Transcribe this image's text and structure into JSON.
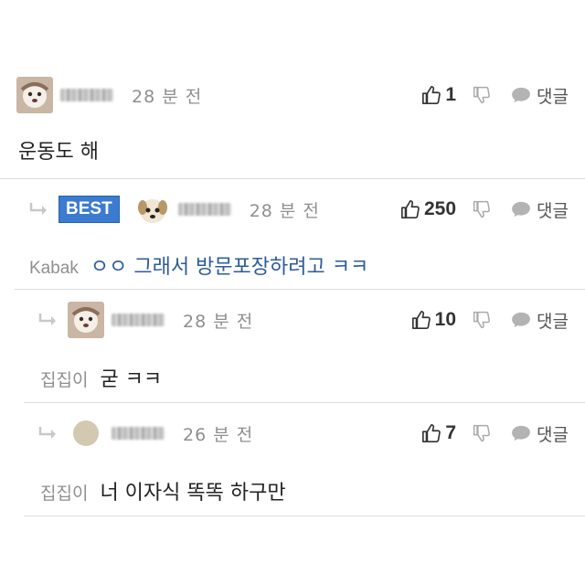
{
  "comments": [
    {
      "id": "c1",
      "time": "28 분 전",
      "likes": "1",
      "reply_label": "댓글",
      "body": "운동도 해"
    },
    {
      "id": "c2",
      "badge": "BEST",
      "time": "28 분 전",
      "likes": "250",
      "reply_label": "댓글",
      "mention": "Kabak",
      "body": "ㅇㅇ 그래서 방문포장하려고 ㅋㅋ"
    },
    {
      "id": "c3",
      "time": "28 분 전",
      "likes": "10",
      "reply_label": "댓글",
      "mention": "집집이",
      "body": "굳 ㅋㅋ"
    },
    {
      "id": "c4",
      "time": "26 분 전",
      "likes": "7",
      "reply_label": "댓글",
      "mention": "집집이",
      "body": "너 이자식 똑똑 하구만"
    }
  ],
  "colors": {
    "best_badge": "#3b7bd0",
    "mention_body": "#2c5b9a",
    "muted": "#8f8f8f"
  },
  "icons": [
    "thumbs-up-icon",
    "thumbs-down-icon",
    "comment-bubble-icon",
    "reply-arrow-icon"
  ]
}
